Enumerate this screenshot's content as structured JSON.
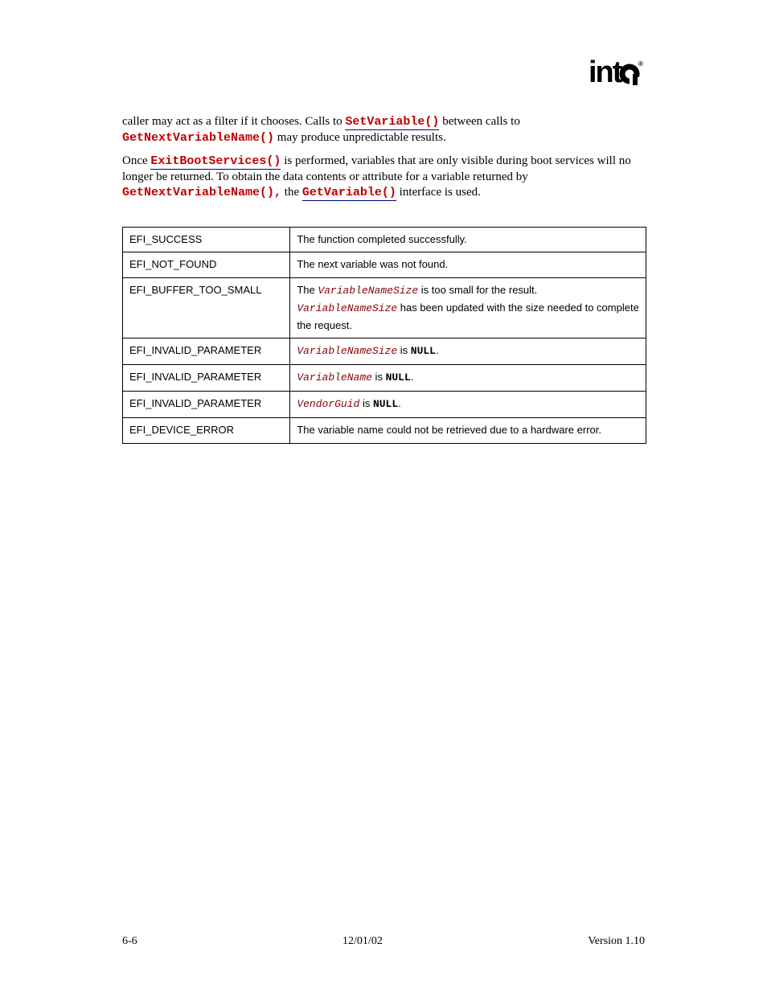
{
  "logo": {
    "text": "intel",
    "registered": "®"
  },
  "paragraphs": {
    "p1_a": "caller may act as a filter if it chooses.  Calls to ",
    "p1_link1": "SetVariable()",
    "p1_b": " between calls to ",
    "p1_code1": "GetNextVariableName()",
    "p1_c": " may produce unpredictable results.",
    "p2_a": "Once ",
    "p2_link1": "ExitBootServices()",
    "p2_b": " is performed, variables that are only visible during boot services will no longer be returned.  To obtain the data contents or attribute for a variable returned by ",
    "p2_code1": "GetNextVariableName(),",
    "p2_c": " the ",
    "p2_link2": "GetVariable()",
    "p2_d": " interface is used."
  },
  "table": {
    "rows": [
      {
        "status": "EFI_SUCCESS",
        "segments": [
          {
            "type": "plain",
            "text": "The function completed successfully."
          }
        ]
      },
      {
        "status": "EFI_NOT_FOUND",
        "segments": [
          {
            "type": "plain",
            "text": "The next variable was not found."
          }
        ]
      },
      {
        "status": "EFI_BUFFER_TOO_SMALL",
        "segments": [
          {
            "type": "plain",
            "text": "The "
          },
          {
            "type": "italic",
            "text": "VariableNameSize"
          },
          {
            "type": "plain",
            "text": " is too small for the result. "
          },
          {
            "type": "italic",
            "text": "VariableNameSize"
          },
          {
            "type": "plain",
            "text": " has been updated with the size needed to complete the request."
          }
        ]
      },
      {
        "status": "EFI_INVALID_PARAMETER",
        "segments": [
          {
            "type": "italic",
            "text": "VariableNameSize"
          },
          {
            "type": "plain",
            "text": " is "
          },
          {
            "type": "boldblack",
            "text": "NULL"
          },
          {
            "type": "plain",
            "text": "."
          }
        ]
      },
      {
        "status": "EFI_INVALID_PARAMETER",
        "segments": [
          {
            "type": "italic",
            "text": "VariableName"
          },
          {
            "type": "plain",
            "text": " is "
          },
          {
            "type": "boldblack",
            "text": "NULL"
          },
          {
            "type": "plain",
            "text": "."
          }
        ]
      },
      {
        "status": "EFI_INVALID_PARAMETER",
        "segments": [
          {
            "type": "italic",
            "text": "VendorGuid"
          },
          {
            "type": "plain",
            "text": " is "
          },
          {
            "type": "boldblack",
            "text": "NULL"
          },
          {
            "type": "plain",
            "text": "."
          }
        ]
      },
      {
        "status": "EFI_DEVICE_ERROR",
        "segments": [
          {
            "type": "plain",
            "text": "The variable name could not be retrieved due to a hardware error."
          }
        ]
      }
    ]
  },
  "footer": {
    "left": "6-6",
    "center": "12/01/02",
    "right": "Version 1.10"
  }
}
